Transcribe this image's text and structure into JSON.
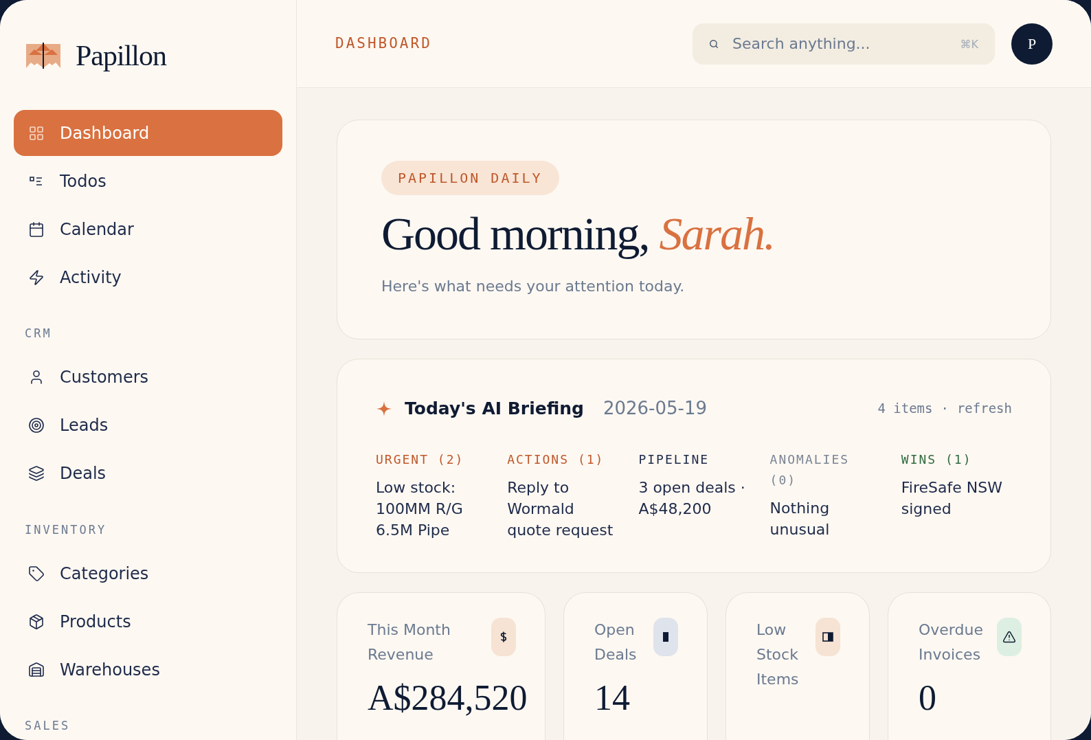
{
  "brand": {
    "name": "Papillon"
  },
  "sidebar": {
    "sections": [
      {
        "items": [
          {
            "label": "Dashboard",
            "kind": "grid",
            "selected": true
          },
          {
            "label": "Todos",
            "kind": "list",
            "selected": false
          },
          {
            "label": "Calendar",
            "kind": "calendar",
            "selected": false
          },
          {
            "label": "Activity",
            "kind": "bolt",
            "selected": false
          }
        ]
      },
      {
        "title": "CRM",
        "items": [
          {
            "label": "Customers",
            "kind": "user",
            "selected": false
          },
          {
            "label": "Leads",
            "kind": "target",
            "selected": false
          },
          {
            "label": "Deals",
            "kind": "layers",
            "selected": false
          }
        ]
      },
      {
        "title": "INVENTORY",
        "items": [
          {
            "label": "Categories",
            "kind": "tag",
            "selected": false
          },
          {
            "label": "Products",
            "kind": "box",
            "selected": false
          },
          {
            "label": "Warehouses",
            "kind": "warehouse",
            "selected": false
          }
        ]
      },
      {
        "title": "SALES"
      }
    ]
  },
  "header": {
    "title": "DASHBOARD",
    "search": {
      "placeholder": "Search anything...",
      "shortcut": "⌘K"
    },
    "avatar": "P"
  },
  "hero": {
    "badge": "PAPILLON DAILY",
    "greeting": "Good morning,",
    "name": "Sarah.",
    "subtitle": "Here's what needs your attention today."
  },
  "briefing": {
    "title": "Today's AI Briefing",
    "date": "2026-05-19",
    "count": "4 items",
    "separator": "·",
    "refresh": "refresh",
    "columns": [
      {
        "label": "URGENT (2)",
        "color": "#c0582a",
        "text": "Low stock: 100MM R/G 6.5M Pipe"
      },
      {
        "label": "ACTIONS (1)",
        "color": "#c0582a",
        "text": "Reply to Wormald quote request"
      },
      {
        "label": "PIPELINE",
        "color": "#1e2a4a",
        "text": "3 open deals · A$48,200"
      },
      {
        "label": "ANOMALIES (0)",
        "color": "#7b8595",
        "text": "Nothing unusual"
      },
      {
        "label": "WINS (1)",
        "color": "#2f6b3f",
        "text": "FireSafe NSW signed"
      }
    ]
  },
  "stats": [
    {
      "label": "This Month Revenue",
      "value": "A$284,520",
      "kind": "dollar",
      "color": "#f6e3d3"
    },
    {
      "label": "Open Deals",
      "value": "14",
      "kind": "bar",
      "color": "#dfe3ec"
    },
    {
      "label": "Low Stock Items",
      "kind": "half",
      "color": "#f6e3d3"
    },
    {
      "label": "Overdue Invoices",
      "value": "0",
      "kind": "warning",
      "color": "#dcefe2"
    }
  ]
}
